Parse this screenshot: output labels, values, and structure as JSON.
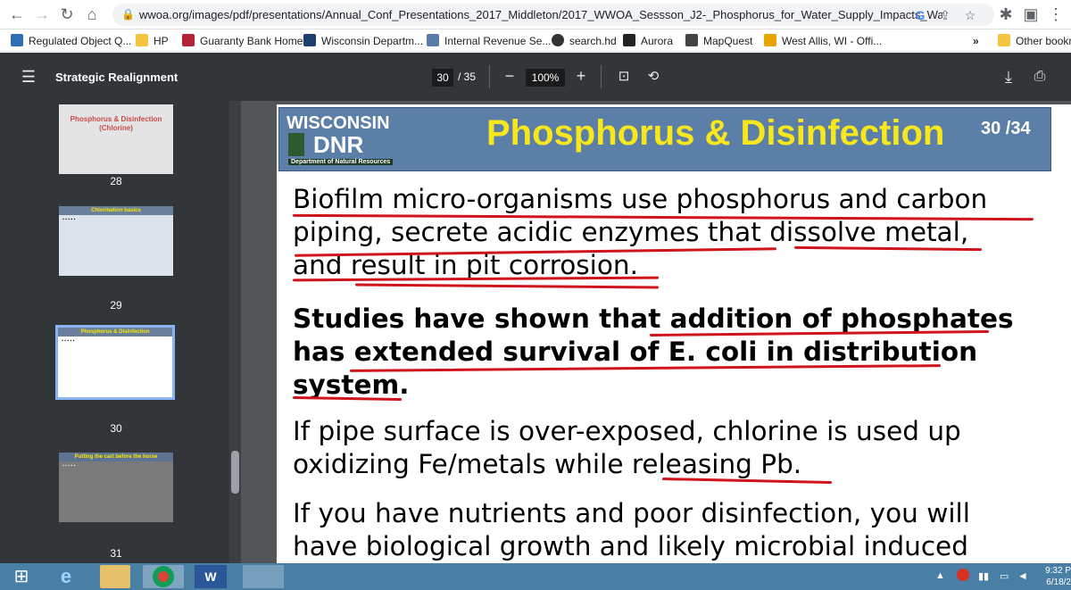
{
  "browser": {
    "url": "wwoa.org/images/pdf/presentations/Annual_Conf_Presentations_2017_Middleton/2017_WWOA_Sessson_J2-_Phosphorus_for_Water_Supply_Impacts_Wa...",
    "bookmarks": [
      "Regulated Object Q...",
      "HP",
      "Guaranty Bank Home",
      "Wisconsin Departm...",
      "Internal Revenue Se...",
      "search.hd",
      "Aurora",
      "MapQuest",
      "West Allis, WI - Offi..."
    ],
    "more": "»",
    "other_bookmarks": "Other bookm"
  },
  "pdf": {
    "title": "Strategic Realignment",
    "page_current": "30",
    "page_total": "/ 35",
    "zoom": "100%"
  },
  "thumbnails": [
    {
      "page": "28",
      "title": "Phosphorus & Disinfection (Chlorine)"
    },
    {
      "page": "29",
      "title": "Chlorination basics"
    },
    {
      "page": "30",
      "title": "Phosphorus & Disinfection"
    },
    {
      "page": "31",
      "title": "Putting the cart before the horse"
    }
  ],
  "slide": {
    "org_line1": "WISCONSIN",
    "org_line2": "DNR",
    "org_line3": "Department of Natural Resources",
    "title": "Phosphorus & Disinfection",
    "number": "30 /34",
    "p1_line1": "Biofilm micro-organisms use phosphorus  and carbon",
    "p1_line2": "piping, secrete acidic enzymes that dissolve metal,",
    "p1_line3": "and result in pit corrosion.",
    "p2_line1": "Studies have shown that addition of phosphates",
    "p2_line2": "has extended survival of E. coli in distribution",
    "p2_line3": "system.",
    "p3_line1": "If pipe surface is over-exposed, chlorine is used up",
    "p3_line2": "oxidizing Fe/metals while releasing Pb.",
    "p4_line1": "If you have nutrients and poor disinfection, you will",
    "p4_line2": "have biological growth and likely microbial induced"
  },
  "taskbar": {
    "time": "9:32 P",
    "date": "6/18/2"
  },
  "colors": {
    "pdf_toolbar": "#323639",
    "viewer_bg": "#525659",
    "slide_banner": "#5b7fa6",
    "slide_title": "#f8e71c",
    "underline": "#d0141b",
    "taskbar": "#4a7fa5"
  },
  "icons": [
    "back-arrow-icon",
    "forward-arrow-icon",
    "reload-icon",
    "home-icon",
    "lock-icon",
    "google-icon",
    "share-icon",
    "star-icon",
    "extensions-icon",
    "sidebar-icon",
    "menu-icon",
    "hamburger-icon",
    "fit-page-icon",
    "rotate-icon",
    "download-icon",
    "print-icon"
  ]
}
